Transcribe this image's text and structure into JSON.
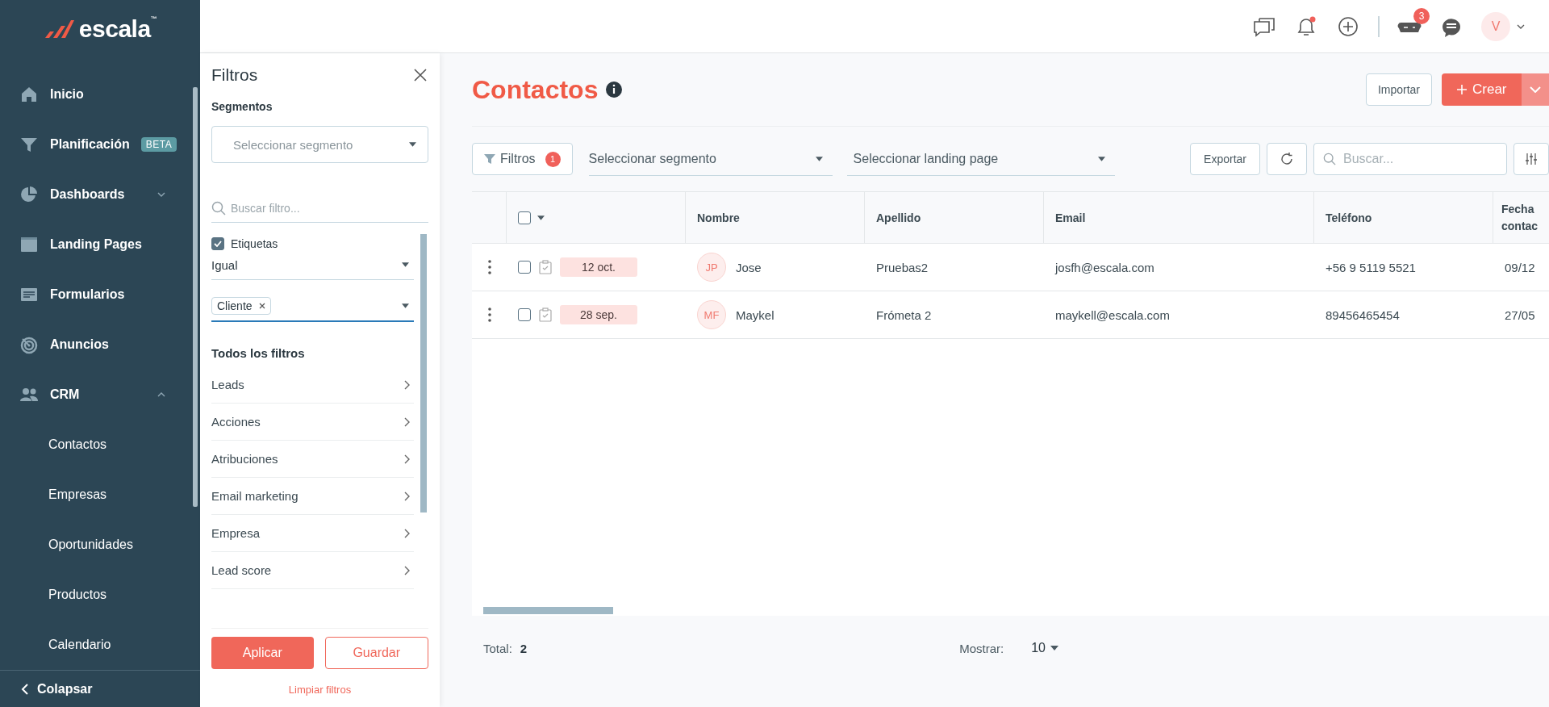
{
  "brand": {
    "name": "escala",
    "tm": "™"
  },
  "header": {
    "chat_badge": "3",
    "bell_unread": true,
    "avatar": "V"
  },
  "sidebar": {
    "items": [
      {
        "label": "Inicio",
        "kind": "link"
      },
      {
        "label": "Planificación",
        "kind": "link",
        "badge": "BETA"
      },
      {
        "label": "Dashboards",
        "kind": "group",
        "expanded": false
      },
      {
        "label": "Landing Pages",
        "kind": "link"
      },
      {
        "label": "Formularios",
        "kind": "link"
      },
      {
        "label": "Anuncios",
        "kind": "link"
      },
      {
        "label": "CRM",
        "kind": "group",
        "expanded": true,
        "children": [
          {
            "label": "Contactos"
          },
          {
            "label": "Empresas"
          },
          {
            "label": "Oportunidades"
          },
          {
            "label": "Productos"
          },
          {
            "label": "Calendario"
          }
        ]
      }
    ],
    "collapse": "Colapsar"
  },
  "filter_panel": {
    "title": "Filtros",
    "segments_label": "Segmentos",
    "segment_placeholder": "Seleccionar segmento",
    "search_placeholder": "Buscar filtro...",
    "active_filter": {
      "label": "Etiquetas",
      "checked": true,
      "operator": "Igual",
      "chips": [
        "Cliente"
      ]
    },
    "all_filters_heading": "Todos los filtros",
    "categories": [
      "Leads",
      "Acciones",
      "Atribuciones",
      "Email marketing",
      "Empresa",
      "Lead score"
    ],
    "apply_button": "Aplicar",
    "save_button": "Guardar",
    "clear_link": "Limpiar filtros"
  },
  "page": {
    "title": "Contactos",
    "import_button": "Importar",
    "create_button": "Crear"
  },
  "toolbar": {
    "filters_button": "Filtros",
    "filters_count": "1",
    "segment_select": "Seleccionar segmento",
    "landing_select": "Seleccionar landing page",
    "export_button": "Exportar",
    "search_placeholder": "Buscar..."
  },
  "table": {
    "select_all_checked": false,
    "columns": [
      "Nombre",
      "Apellido",
      "Email",
      "Teléfono",
      "Fecha contac"
    ],
    "rows": [
      {
        "checked": false,
        "date_tag": "12 oct.",
        "initials": "JP",
        "cells": [
          "Jose",
          "Pruebas2",
          "josfh@escala.com",
          "+56 9 5119 5521",
          "09/12"
        ]
      },
      {
        "checked": false,
        "date_tag": "28 sep.",
        "initials": "MF",
        "cells": [
          "Maykel",
          "Frómeta 2",
          "maykell@escala.com",
          "89456465454",
          "27/05"
        ]
      }
    ]
  },
  "footer": {
    "total_label": "Total:",
    "total": "2",
    "show_label": "Mostrar:",
    "page_size": "10"
  }
}
